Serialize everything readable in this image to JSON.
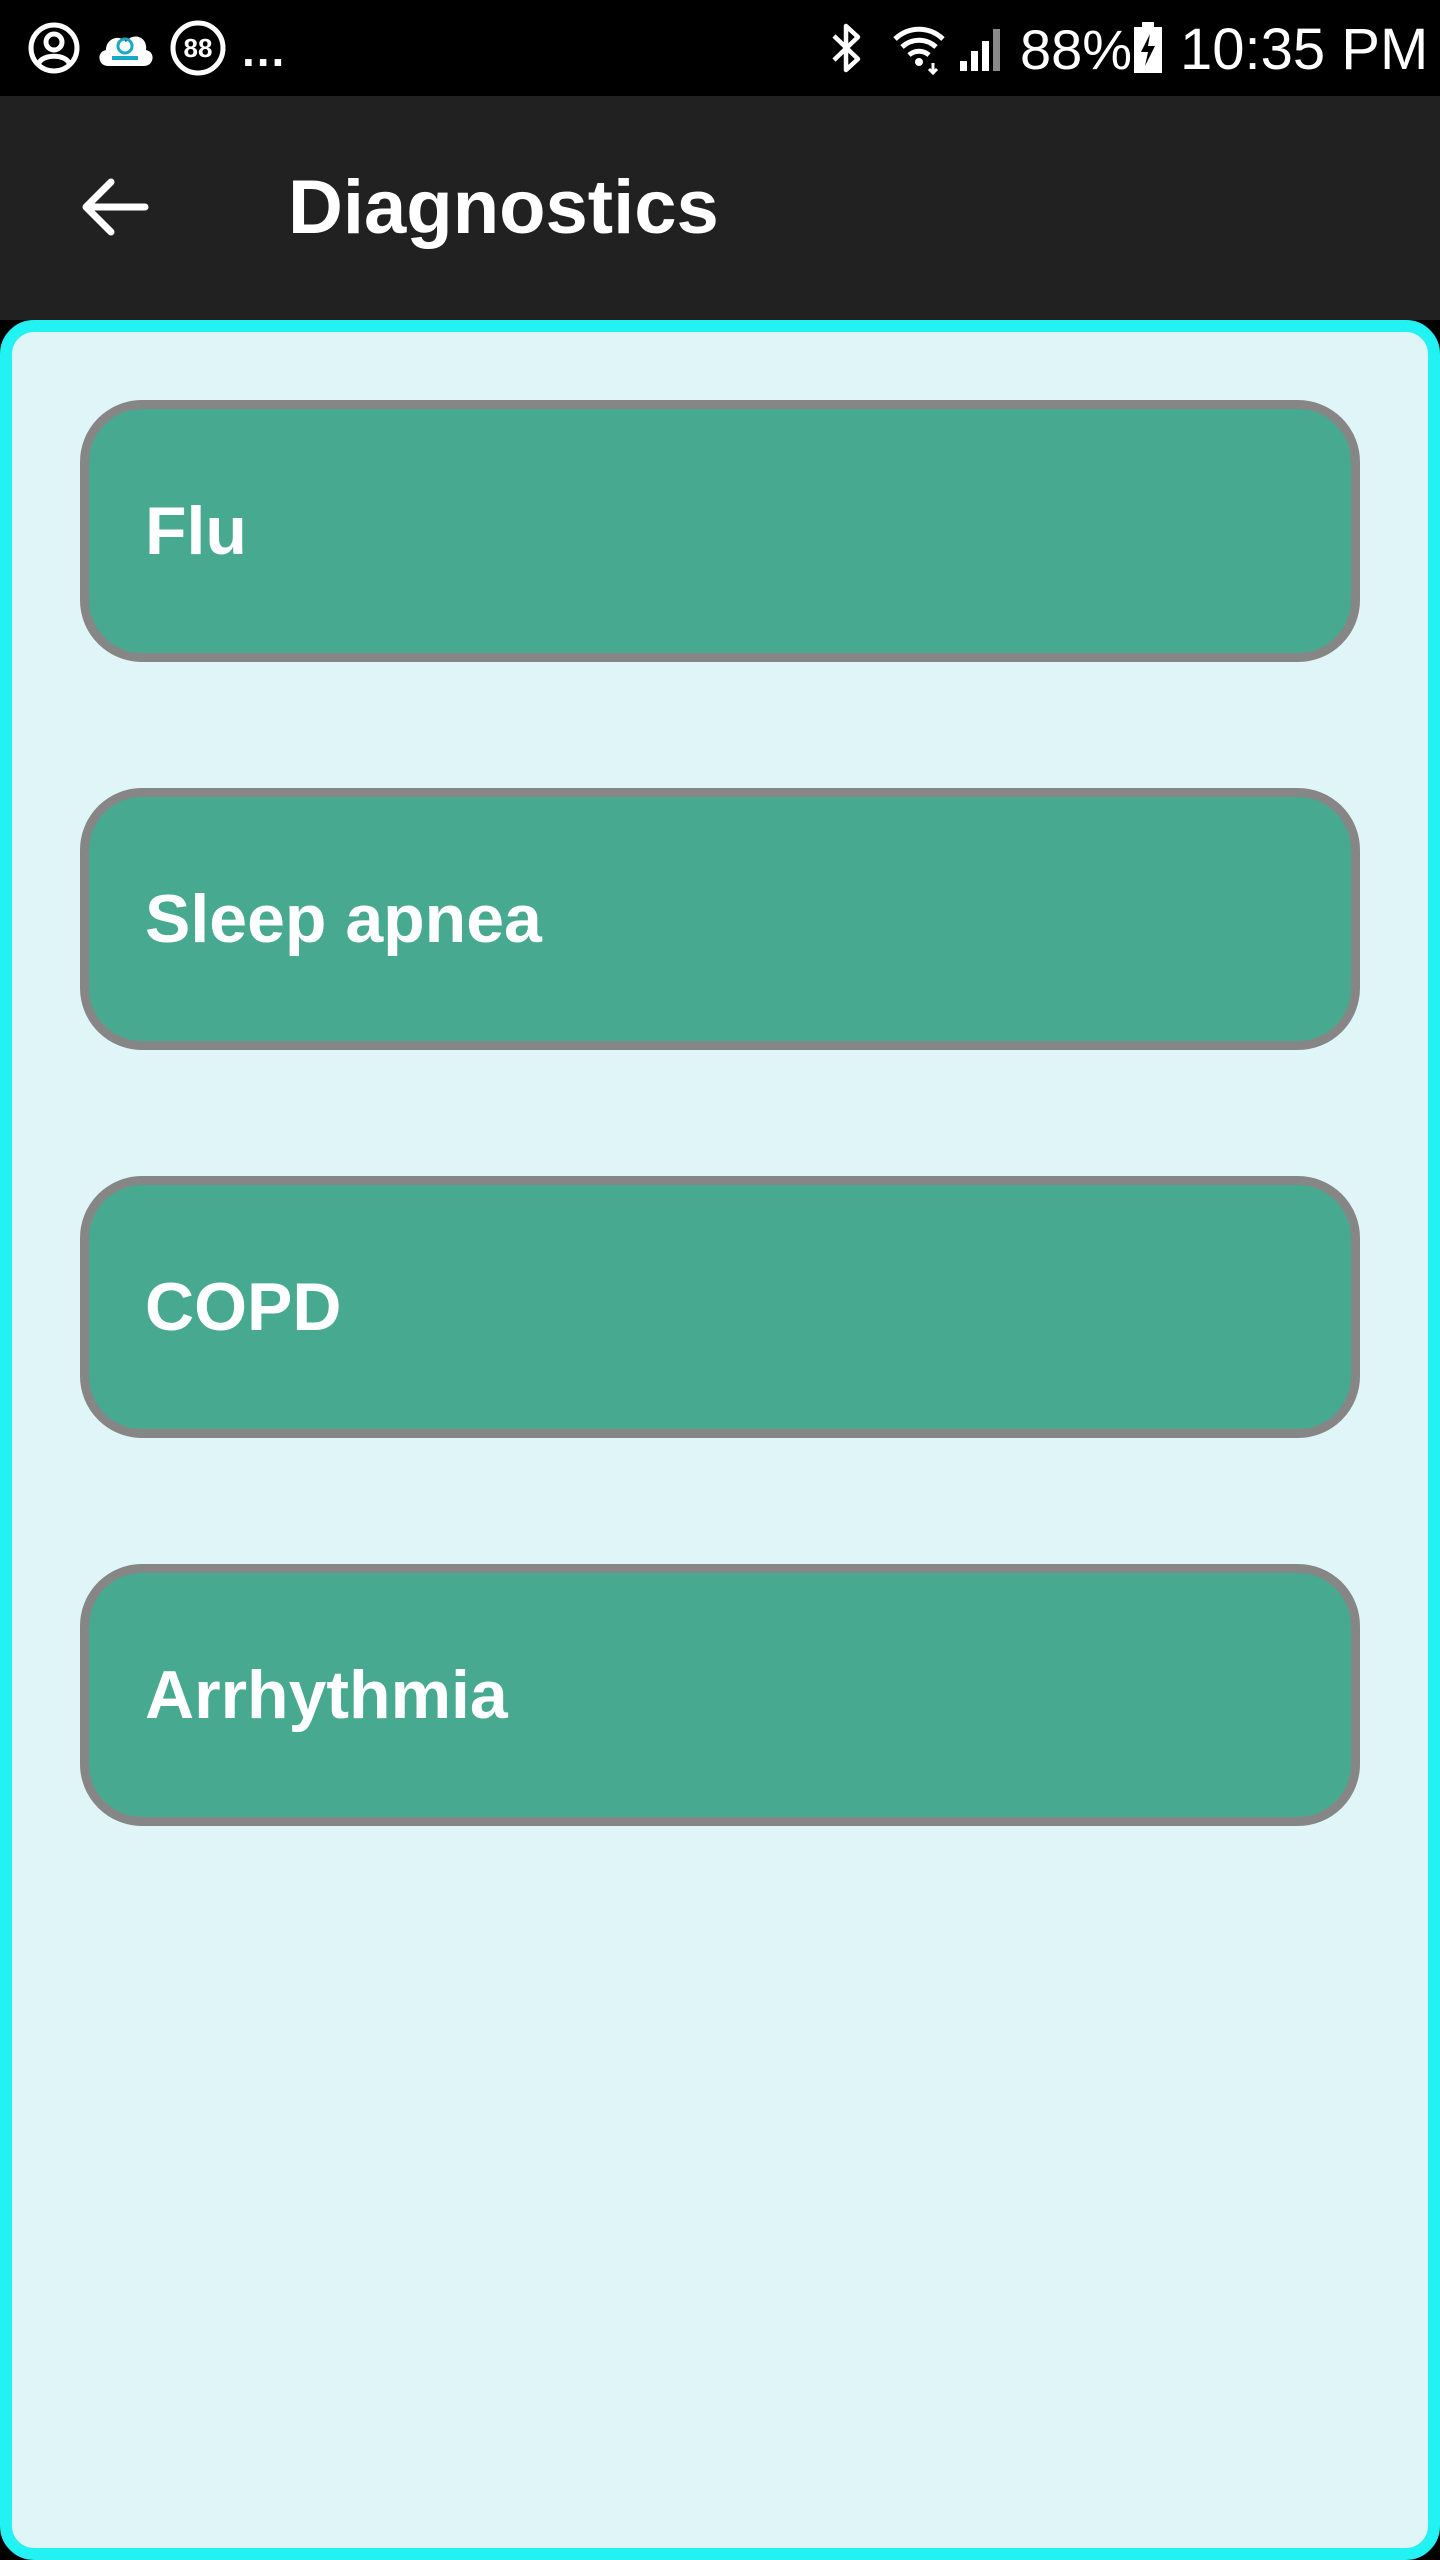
{
  "status_bar": {
    "icons_left": [
      "account-circle-icon",
      "cloud-app-icon",
      "badge-88-icon"
    ],
    "badge_count": "88",
    "more": "...",
    "icons_right": [
      "bluetooth-icon",
      "wifi-icon",
      "cellular-signal-icon",
      "battery-charging-icon"
    ],
    "battery_percent": "88%",
    "time": "10:35 PM"
  },
  "app_bar": {
    "back_icon": "arrow-back-icon",
    "title": "Diagnostics"
  },
  "diagnostics": {
    "items": [
      {
        "label": "Flu"
      },
      {
        "label": "Sleep apnea"
      },
      {
        "label": "COPD"
      },
      {
        "label": "Arrhythmia"
      }
    ]
  },
  "colors": {
    "status_bar_bg": "#000000",
    "app_bar_bg": "#212121",
    "panel_bg": "#e0f5f7",
    "panel_border": "#22f2f2",
    "button_fill": "#48a991",
    "button_border": "#868686",
    "text_light": "#ffffff"
  }
}
